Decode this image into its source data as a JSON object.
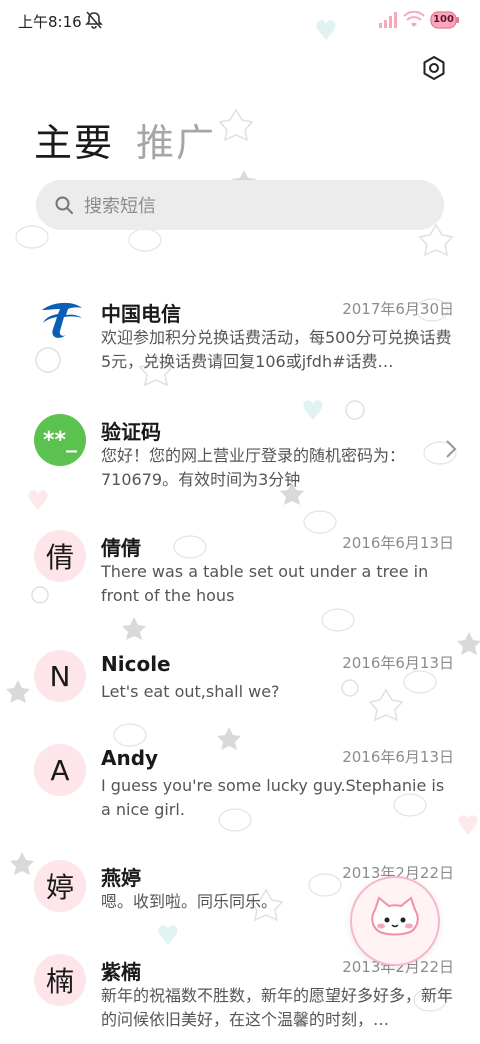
{
  "status_bar": {
    "time": "上午8:16",
    "battery": "100",
    "icons": [
      "mute-icon",
      "signal-icon",
      "wifi-icon",
      "battery-icon"
    ]
  },
  "header": {
    "tabs": [
      {
        "label": "主要",
        "active": true
      },
      {
        "label": "推广",
        "active": false
      }
    ],
    "settings_icon": "gear-icon"
  },
  "search": {
    "placeholder": "搜索短信"
  },
  "messages": [
    {
      "sender": "中国电信",
      "date": "2017年6月30日",
      "preview": "欢迎参加积分兑换话费活动，每500分可兑换话费5元，兑换话费请回复106或jfdh#话费…",
      "avatar": {
        "type": "logo",
        "icon": "china-telecom-logo"
      }
    },
    {
      "sender": "验证码",
      "date": "",
      "preview": "您好！您的网上营业厅登录的随机密码为：710679。有效时间为3分钟",
      "avatar": {
        "type": "text",
        "text": "**_",
        "color": "#5cc24f"
      },
      "has_chevron": true
    },
    {
      "sender": "倩倩",
      "date": "2016年6月13日",
      "preview": "There was a table set out under a tree in front of the hous",
      "avatar": {
        "type": "text",
        "text": "倩"
      }
    },
    {
      "sender": "Nicole",
      "date": "2016年6月13日",
      "preview": "Let's eat out,shall we?",
      "avatar": {
        "type": "text",
        "text": "N"
      }
    },
    {
      "sender": "Andy",
      "date": "2016年6月13日",
      "preview": "I guess you're some lucky guy.Stephanie is a nice girl.",
      "avatar": {
        "type": "text",
        "text": "A"
      }
    },
    {
      "sender": "燕婷",
      "date": "2013年2月22日",
      "preview": "嗯。收到啦。同乐同乐。",
      "avatar": {
        "type": "text",
        "text": "婷"
      }
    },
    {
      "sender": "紫楠",
      "date": "2013年2月22日",
      "preview": "新年的祝福数不胜数，新年的愿望好多好多，新年的问候依旧美好，在这个温馨的时刻，…",
      "avatar": {
        "type": "text",
        "text": "楠"
      }
    }
  ],
  "fab": {
    "icon": "cat-compose-icon"
  },
  "colors": {
    "accent_pink": "#f6b9c6",
    "avatar_bg": "#fde5ea",
    "telecom_blue": "#0a5fb4",
    "verify_green": "#5cc24f"
  }
}
